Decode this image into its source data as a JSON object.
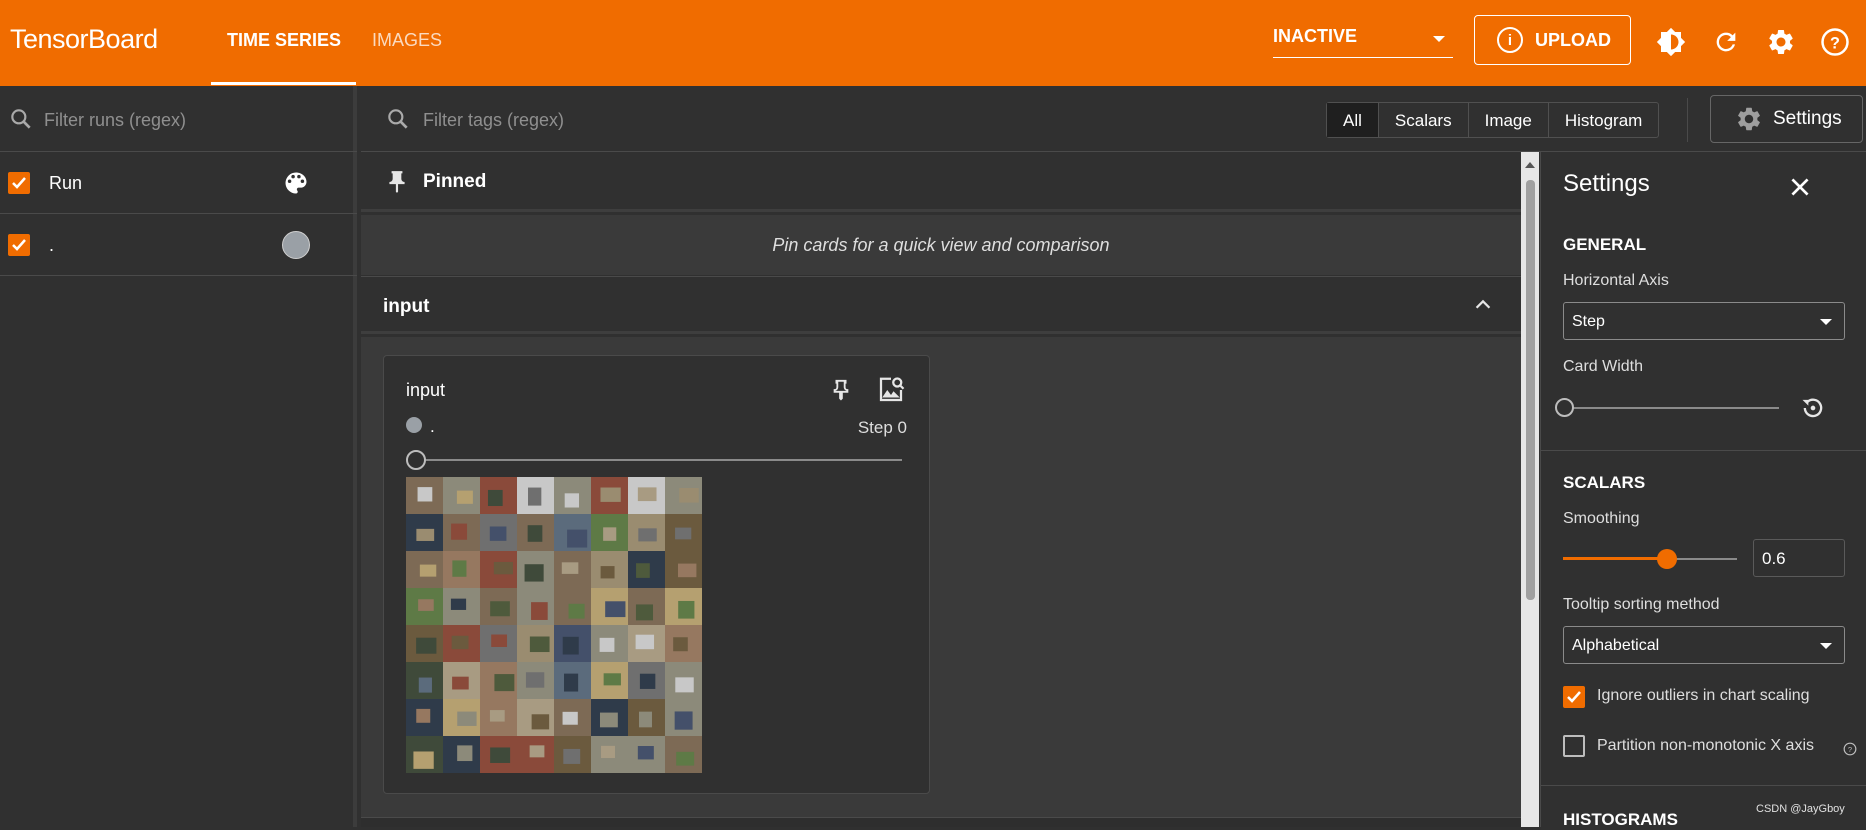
{
  "header": {
    "brand": "TensorBoard",
    "tabs": [
      {
        "label": "TIME SERIES",
        "active": true
      },
      {
        "label": "IMAGES",
        "active": false
      }
    ],
    "status_select": "INACTIVE",
    "upload_label": "UPLOAD",
    "accent_color": "#f06c00"
  },
  "runs_panel": {
    "filter_placeholder": "Filter runs (regex)",
    "runs": [
      {
        "label": "Run",
        "checked": true,
        "icon": "palette-icon"
      },
      {
        "label": ".",
        "checked": true,
        "color": "#9aa0a6"
      }
    ]
  },
  "main": {
    "filter_placeholder": "Filter tags (regex)",
    "type_filters": [
      "All",
      "Scalars",
      "Image",
      "Histogram"
    ],
    "selected_type": "All",
    "settings_button": "Settings",
    "pinned": {
      "title": "Pinned",
      "empty_message": "Pin cards for a quick view and comparison"
    },
    "group": {
      "title": "input",
      "card": {
        "title": "input",
        "run_label": ".",
        "step_label": "Step 0"
      }
    }
  },
  "settings": {
    "title": "Settings",
    "general": {
      "heading": "GENERAL",
      "horizontal_axis_label": "Horizontal Axis",
      "horizontal_axis_value": "Step",
      "card_width_label": "Card Width"
    },
    "scalars": {
      "heading": "SCALARS",
      "smoothing_label": "Smoothing",
      "smoothing_value": "0.6",
      "smoothing_fraction": 0.6,
      "tooltip_sort_label": "Tooltip sorting method",
      "tooltip_sort_value": "Alphabetical",
      "ignore_outliers_label": "Ignore outliers in chart scaling",
      "ignore_outliers": true,
      "partition_label": "Partition non-monotonic X axis",
      "partition": false
    },
    "histograms": {
      "heading": "HISTOGRAMS"
    }
  },
  "watermark": "CSDN @JayGboy"
}
